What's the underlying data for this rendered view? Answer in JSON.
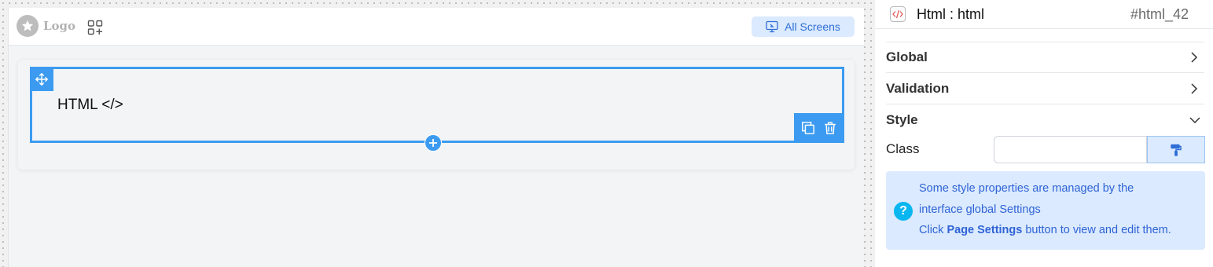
{
  "canvas": {
    "logo_text": "Logo",
    "all_screens_label": "All Screens",
    "html_element_label": "HTML </>"
  },
  "panel": {
    "element_title": "Html : html",
    "element_id": "#html_42",
    "sections": {
      "global": "Global",
      "validation": "Validation",
      "style": "Style"
    },
    "class_label": "Class",
    "class_value": "",
    "info": {
      "line1": "Some style properties are managed by the",
      "line2": "interface global Settings",
      "line3_prefix": "Click ",
      "line3_bold": "Page Settings",
      "line3_suffix": " button to view and edit them.",
      "icon_glyph": "?"
    }
  },
  "colors": {
    "accent": "#3c9bf1",
    "accent_light": "#dbeafe",
    "link_text": "#2f63d6",
    "info_icon": "#09b6f0"
  },
  "icons": [
    "star-icon",
    "apps-icon",
    "monitor-icon",
    "move-icon",
    "copy-icon",
    "trash-icon",
    "plus-icon",
    "code-icon",
    "chevron-right-icon",
    "chevron-down-icon",
    "paint-roller-icon",
    "question-icon"
  ]
}
